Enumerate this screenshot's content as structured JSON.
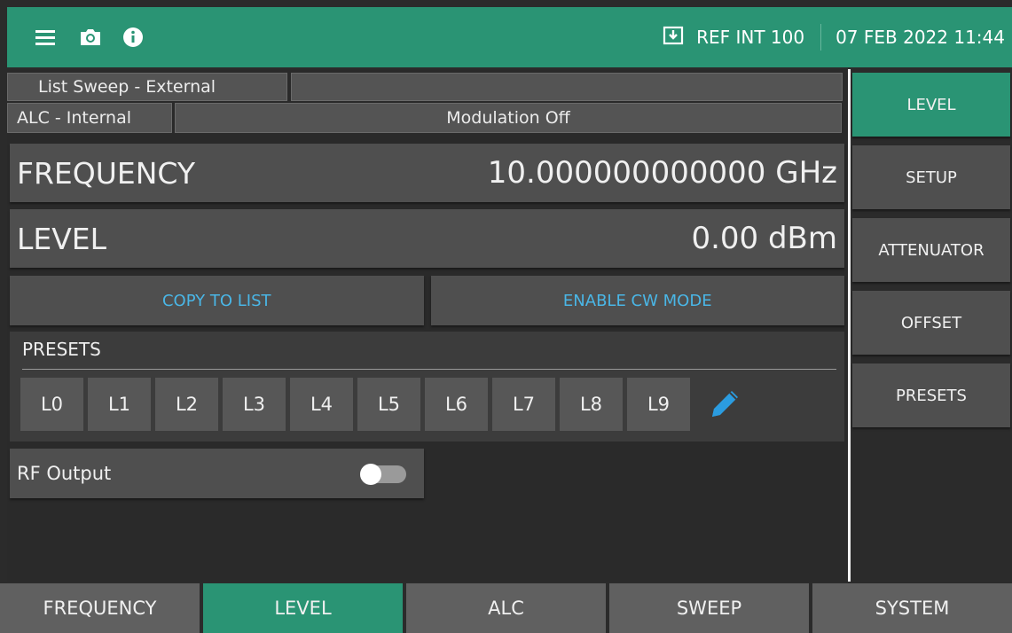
{
  "colors": {
    "accent": "#2a9474",
    "action_text": "#4ab6e6",
    "panel": "#4f4f4f",
    "background": "#2b2b2b"
  },
  "topbar": {
    "icons": [
      "menu-icon",
      "camera-icon",
      "info-icon",
      "download-icon"
    ],
    "ref": "REF INT 100",
    "datetime": "07 FEB 2022 11:44"
  },
  "status": {
    "sweep_mode": "List Sweep - External",
    "alc_mode": "ALC - Internal",
    "modulation": "Modulation Off"
  },
  "frequency": {
    "label": "FREQUENCY",
    "value": "10.000000000000",
    "unit": "GHz"
  },
  "level": {
    "label": "LEVEL",
    "value": "0.00",
    "unit": "dBm"
  },
  "actions": {
    "copy_to_list": "COPY TO LIST",
    "enable_cw_mode": "ENABLE CW MODE"
  },
  "presets": {
    "title": "PRESETS",
    "keys": [
      "L0",
      "L1",
      "L2",
      "L3",
      "L4",
      "L5",
      "L6",
      "L7",
      "L8",
      "L9"
    ]
  },
  "rf_output": {
    "label": "RF Output",
    "enabled": false
  },
  "side_menu": {
    "items": [
      "LEVEL",
      "SETUP",
      "ATTENUATOR",
      "OFFSET",
      "PRESETS"
    ],
    "active": "LEVEL"
  },
  "bottom_tabs": {
    "items": [
      "FREQUENCY",
      "LEVEL",
      "ALC",
      "SWEEP",
      "SYSTEM"
    ],
    "active": "LEVEL"
  }
}
